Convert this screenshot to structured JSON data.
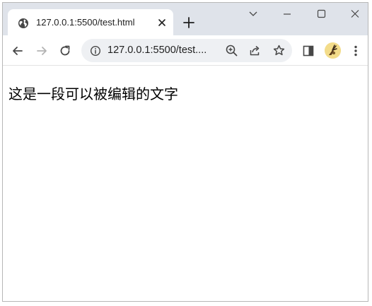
{
  "tab": {
    "title": "127.0.0.1:5500/test.html",
    "favicon": "globe-icon",
    "close": "close-icon"
  },
  "window_controls": [
    "chevron-down-icon",
    "minimize-icon",
    "maximize-icon",
    "close-icon"
  ],
  "toolbar": {
    "back": "back-arrow-icon",
    "forward": "forward-arrow-icon",
    "reload": "reload-icon",
    "url": "127.0.0.1:5500/test....",
    "site_info": "info-icon",
    "omnibox_actions": [
      "zoom-icon",
      "share-icon",
      "star-icon"
    ],
    "side_panel": "side-panel-icon",
    "profile": "avatar",
    "menu": "more-vertical-icon"
  },
  "page": {
    "text": "这是一段可以被编辑的文字"
  },
  "colors": {
    "titlebar": "#dfe3ea",
    "omnibox": "#eef0f3",
    "icon": "#474747",
    "avatar": "#f3dc8a"
  }
}
